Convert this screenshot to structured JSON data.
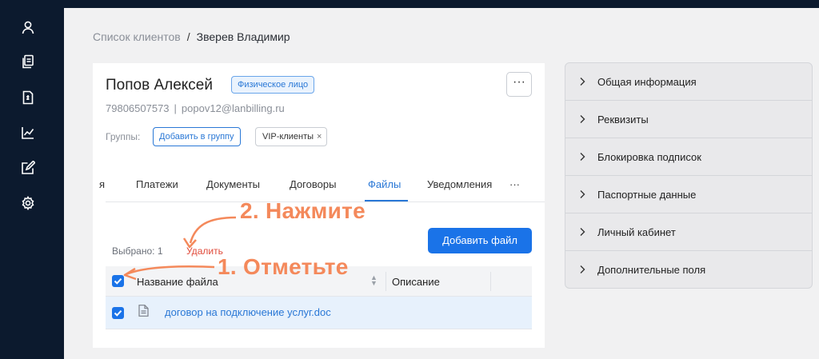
{
  "breadcrumb": {
    "parent": "Список клиентов",
    "separator": "/",
    "current": "Зверев Владимир"
  },
  "client": {
    "name": "Попов Алексей",
    "type_badge": "Физическое лицо",
    "more_label": "···",
    "phone": "79806507573",
    "contact_separator": "|",
    "email": "popov12@lanbilling.ru",
    "groups_label": "Группы:",
    "add_group_label": "Добавить в группу",
    "group_tag": "VIP-клиенты",
    "group_tag_remove": "×"
  },
  "tabs": [
    {
      "label": "я"
    },
    {
      "label": "Платежи"
    },
    {
      "label": "Документы"
    },
    {
      "label": "Договоры"
    },
    {
      "label": "Файлы",
      "active": true
    },
    {
      "label": "Уведомления"
    },
    {
      "label": "···"
    }
  ],
  "files": {
    "selected_text": "Выбрано: 1",
    "delete_label": "Удалить",
    "add_file_label": "Добавить файл",
    "columns": {
      "name": "Название файла",
      "description": "Описание"
    },
    "rows": [
      {
        "name": "договор на подключение услуг.doc",
        "description": "",
        "checked": true
      }
    ]
  },
  "annotations": {
    "step1": "1. Отметьте",
    "step2": "2. Нажмите",
    "color": "#f4895b"
  },
  "panel": {
    "items": [
      "Общая информация",
      "Реквизиты",
      "Блокировка подписок",
      "Паспортные данные",
      "Личный кабинет",
      "Дополнительные поля"
    ]
  },
  "sidebar_icons": [
    "user-icon",
    "documents-icon",
    "invoice-icon",
    "chart-icon",
    "edit-icon",
    "gear-icon"
  ],
  "colors": {
    "accent": "#1a73e8",
    "sidebar": "#0c1a2e",
    "danger": "#e04a3a"
  }
}
